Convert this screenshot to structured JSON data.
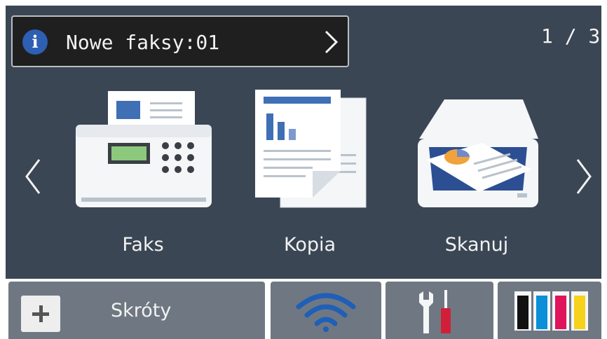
{
  "notification": {
    "text": "Nowe faksy:01",
    "icon": "info-icon",
    "icon_glyph": "i",
    "chevron": "chevron-right-icon"
  },
  "pager": {
    "text": "1 / 3"
  },
  "apps": [
    {
      "label": "Faks",
      "icon": "fax-machine-icon"
    },
    {
      "label": "Kopia",
      "icon": "copy-document-icon"
    },
    {
      "label": "Skanuj",
      "icon": "scanner-icon"
    }
  ],
  "nav": {
    "prev_icon": "chevron-left-icon",
    "next_icon": "chevron-right-icon"
  },
  "bottom_bar": {
    "shortcuts_label": "Skróty",
    "shortcuts_icon": "plus-icon",
    "wifi_icon": "wifi-icon",
    "settings_icon": "tools-icon",
    "ink_icon": "ink-cartridges-icon"
  },
  "colors": {
    "panel_bg": "#3b4654",
    "button_bg": "#6f7882",
    "info_blue": "#2d5fb2",
    "wifi_blue": "#1f5fb8",
    "ink_black": "#111111",
    "ink_cyan": "#0b8fd8",
    "ink_magenta": "#e0145a",
    "ink_yellow": "#f6d21a"
  }
}
